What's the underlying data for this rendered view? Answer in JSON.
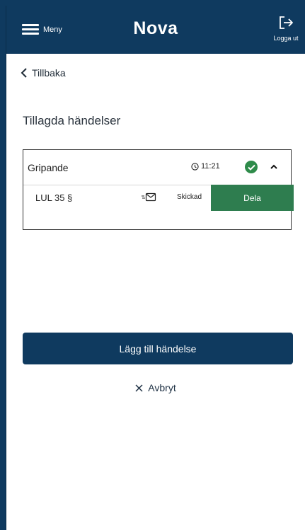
{
  "header": {
    "menu_label": "Meny",
    "brand": "Nova",
    "logout_label": "Logga ut"
  },
  "nav": {
    "back_label": "Tillbaka"
  },
  "section": {
    "title": "Tillagda händelser"
  },
  "event": {
    "title": "Gripande",
    "time": "11:21",
    "law": "LUL 35 §",
    "status": "Skickad",
    "share_label": "Dela"
  },
  "actions": {
    "add_label": "Lägg till händelse",
    "cancel_label": "Avbryt"
  },
  "colors": {
    "primary": "#0f3a5f",
    "success": "#2e8b4a",
    "share": "#2e7d4f"
  },
  "icons": [
    "menu-icon",
    "logout-icon",
    "chevron-left-icon",
    "clock-icon",
    "check-circle-icon",
    "chevron-up-icon",
    "mail-sent-icon",
    "close-icon"
  ]
}
